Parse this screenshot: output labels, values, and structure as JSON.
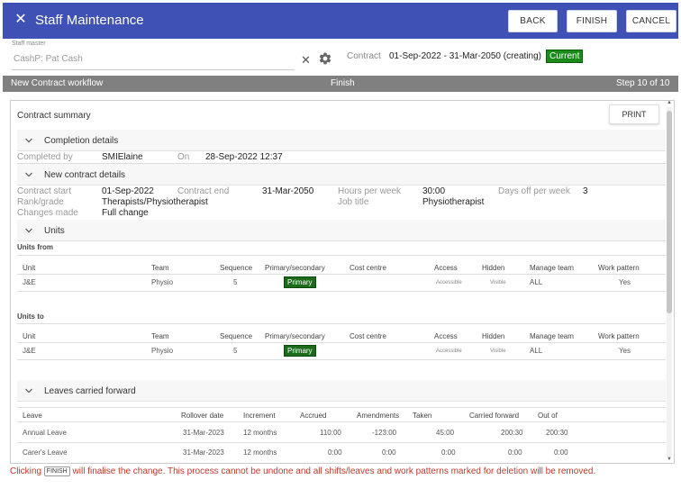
{
  "header": {
    "title": "Staff Maintenance",
    "back": "BACK",
    "finish": "FINISH",
    "cancel": "CANCEL",
    "color": "#3f51b5"
  },
  "staff": {
    "label": "Staff master",
    "value": "CashP: Pat Cash"
  },
  "contract": {
    "label": "Contract",
    "value": "01-Sep-2022 - 31-Mar-2050 (creating)",
    "badge": "Current",
    "badge_color": "#1b8a1b"
  },
  "workflow": {
    "name": "New Contract workflow",
    "step_name": "Finish",
    "step": "Step 10 of 10"
  },
  "summary": {
    "title": "Contract summary",
    "print": "PRINT",
    "completion": {
      "heading": "Completion details",
      "completed_by_label": "Completed by",
      "completed_by": "SMIElaine",
      "on_label": "On",
      "on": "28-Sep-2022 12:37"
    },
    "new_contract": {
      "heading": "New contract details",
      "start_label": "Contract start",
      "start": "01-Sep-2022",
      "end_label": "Contract end",
      "end": "31-Mar-2050",
      "hours_label": "Hours per week",
      "hours": "30:00",
      "days_off_label": "Days off per week",
      "days_off": "3",
      "rank_label": "Rank/grade",
      "rank": "Therapists/Physiotherapist",
      "job_label": "Job title",
      "job": "Physiotherapist",
      "changes_label": "Changes made",
      "changes": "Full change"
    },
    "units": {
      "heading": "Units",
      "from_label": "Units from",
      "to_label": "Units to",
      "columns": [
        "Unit",
        "Team",
        "Sequence",
        "Primary/secondary",
        "Cost centre",
        "Access",
        "Hidden",
        "Manage team",
        "Work pattern"
      ],
      "from_row": {
        "unit": "J&E",
        "team": "Physio",
        "sequence": "5",
        "primary": "Primary",
        "cost_centre": "",
        "access": "Accessible",
        "hidden": "Visible",
        "manage_team": "ALL",
        "work_pattern": "Yes"
      },
      "to_row": {
        "unit": "J&E",
        "team": "Physio",
        "sequence": "5",
        "primary": "Primary",
        "cost_centre": "",
        "access": "Accessible",
        "hidden": "Visible",
        "manage_team": "ALL",
        "work_pattern": "Yes"
      }
    },
    "leaves": {
      "heading": "Leaves carried forward",
      "columns": [
        "Leave",
        "Rollover date",
        "Increment",
        "Accrued",
        "Amendments",
        "Taken",
        "Carried forward",
        "Out of"
      ],
      "rows": [
        {
          "leave": "Annual Leave",
          "rollover": "31-Mar-2023",
          "increment": "12 months",
          "accrued": "110:00",
          "amendments": "-123:00",
          "taken": "45:00",
          "carried": "200:30",
          "out_of": "200:30"
        },
        {
          "leave": "Carer's Leave",
          "rollover": "31-Mar-2023",
          "increment": "12 months",
          "accrued": "0:00",
          "amendments": "0:00",
          "taken": "0:00",
          "carried": "0:00",
          "out_of": "0:00"
        }
      ]
    }
  },
  "footer": {
    "before": "Clicking",
    "button": "FINISH",
    "after": "will finalise the change. This process cannot be undone and all shifts/leaves and work patterns marked for deletion will be removed.",
    "color": "#c0392b"
  },
  "icons": {
    "close": "close-icon",
    "clear": "clear-icon",
    "settings": "gear-icon",
    "collapse": "chevron-down-icon"
  }
}
